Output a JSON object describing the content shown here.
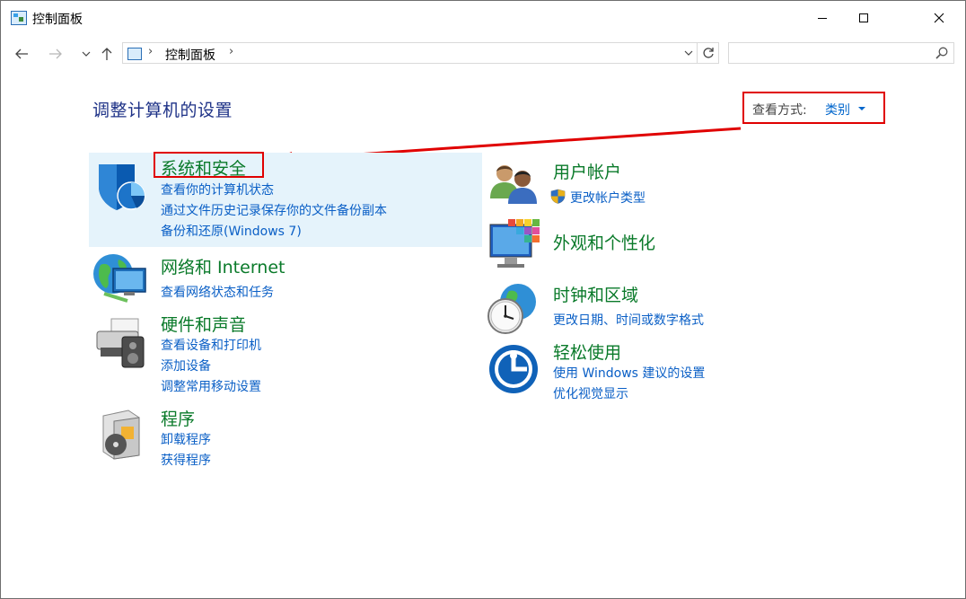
{
  "window": {
    "title": "控制面板",
    "controls": {
      "minimize": "minimize",
      "maximize": "maximize",
      "close": "close"
    }
  },
  "nav": {
    "breadcrumb": "控制面板",
    "search_placeholder": ""
  },
  "header": {
    "heading": "调整计算机的设置",
    "view_by_label": "查看方式:",
    "view_by_value": "类别"
  },
  "categories": {
    "system_security": {
      "title": "系统和安全",
      "links": [
        "查看你的计算机状态",
        "通过文件历史记录保存你的文件备份副本",
        "备份和还原(Windows 7)"
      ]
    },
    "network": {
      "title": "网络和 Internet",
      "links": [
        "查看网络状态和任务"
      ]
    },
    "hardware": {
      "title": "硬件和声音",
      "links": [
        "查看设备和打印机",
        "添加设备",
        "调整常用移动设置"
      ]
    },
    "programs": {
      "title": "程序",
      "links": [
        "卸载程序",
        "获得程序"
      ]
    },
    "user_accounts": {
      "title": "用户帐户",
      "links": [
        "更改帐户类型"
      ]
    },
    "appearance": {
      "title": "外观和个性化",
      "links": []
    },
    "clock_region": {
      "title": "时钟和区域",
      "links": [
        "更改日期、时间或数字格式"
      ]
    },
    "ease_access": {
      "title": "轻松使用",
      "links": [
        "使用 Windows 建议的设置",
        "优化视觉显示"
      ]
    }
  },
  "colors": {
    "category_title": "#0a7a2a",
    "link": "#0a5fc6",
    "heading": "#1e3287",
    "highlight": "#e5f3fb",
    "annotation": "#e00000"
  }
}
